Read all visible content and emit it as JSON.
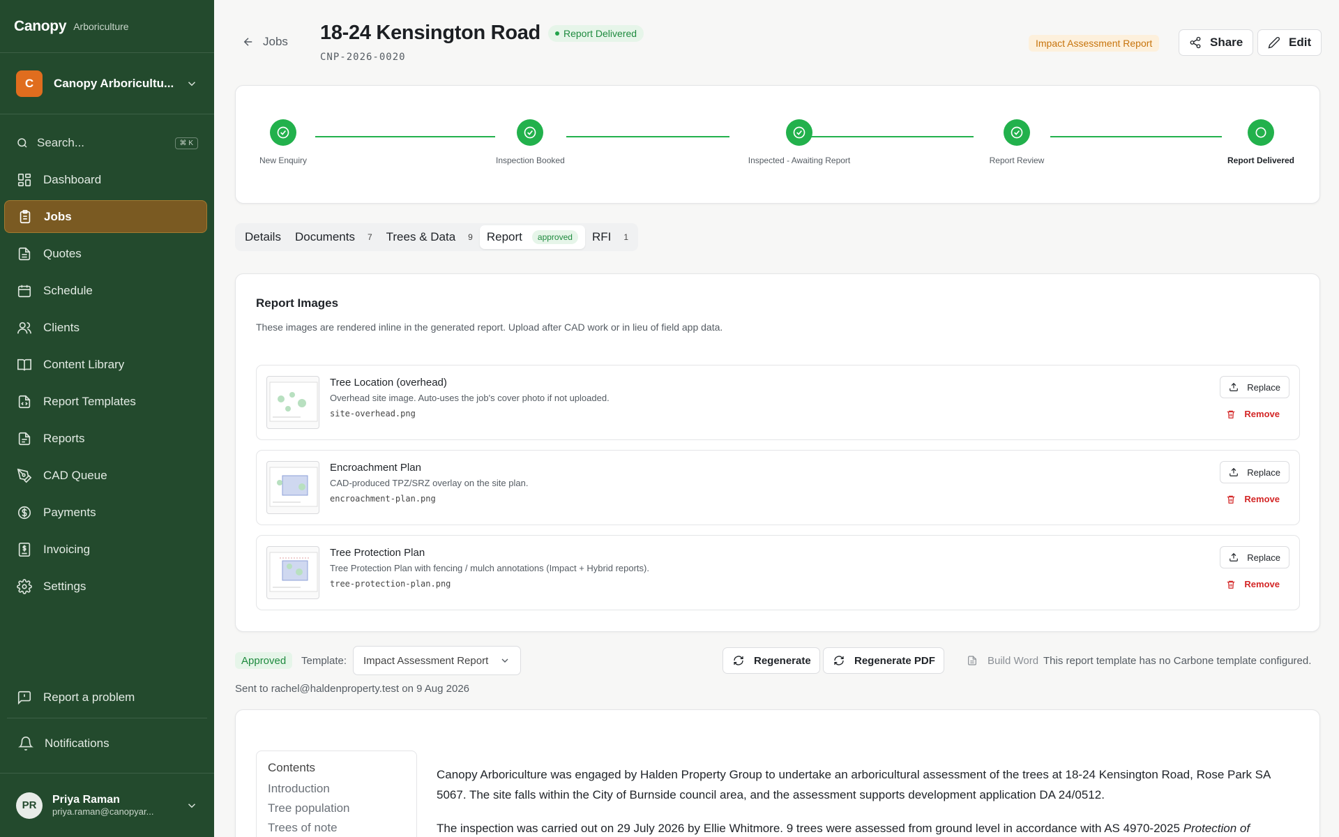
{
  "brand": {
    "name": "Canopy",
    "sub": "Arboriculture"
  },
  "org": {
    "initial": "C",
    "name": "Canopy Arboricultu..."
  },
  "search": {
    "label": "Search...",
    "shortcut": "⌘ K"
  },
  "nav": {
    "items": [
      {
        "label": "Dashboard",
        "icon": "dashboard-icon"
      },
      {
        "label": "Jobs",
        "icon": "clipboard-icon"
      },
      {
        "label": "Quotes",
        "icon": "document-icon"
      },
      {
        "label": "Schedule",
        "icon": "calendar-icon"
      },
      {
        "label": "Clients",
        "icon": "users-icon"
      },
      {
        "label": "Content Library",
        "icon": "book-icon"
      },
      {
        "label": "Report Templates",
        "icon": "file-code-icon"
      },
      {
        "label": "Reports",
        "icon": "file-text-icon"
      },
      {
        "label": "CAD Queue",
        "icon": "pen-tool-icon"
      },
      {
        "label": "Payments",
        "icon": "dollar-circle-icon"
      },
      {
        "label": "Invoicing",
        "icon": "invoice-icon"
      },
      {
        "label": "Settings",
        "icon": "gear-icon"
      }
    ],
    "report_problem": "Report a problem",
    "notifications": "Notifications"
  },
  "user": {
    "initials": "PR",
    "name": "Priya Raman",
    "email": "priya.raman@canopyar..."
  },
  "header": {
    "back_label": "Jobs",
    "title": "18-24 Kensington Road",
    "status": "Report Delivered",
    "job_code": "CNP-2026-0020",
    "report_type": "Impact Assessment Report",
    "share_label": "Share",
    "edit_label": "Edit"
  },
  "stepper": {
    "steps": [
      {
        "label": "New Enquiry",
        "state": "done"
      },
      {
        "label": "Inspection Booked",
        "state": "done"
      },
      {
        "label": "Inspected - Awaiting Report",
        "state": "done"
      },
      {
        "label": "Report Review",
        "state": "done"
      },
      {
        "label": "Report Delivered",
        "state": "current"
      }
    ]
  },
  "tabs": [
    {
      "label": "Details",
      "count": ""
    },
    {
      "label": "Documents",
      "count": "7"
    },
    {
      "label": "Trees & Data",
      "count": "9"
    },
    {
      "label": "Report",
      "badge": "approved"
    },
    {
      "label": "RFI",
      "count": "1"
    }
  ],
  "report_images": {
    "title": "Report Images",
    "subtitle": "These images are rendered inline in the generated report. Upload after CAD work or in lieu of field app data.",
    "replace_label": "Replace",
    "remove_label": "Remove",
    "items": [
      {
        "title": "Tree Location (overhead)",
        "desc": "Overhead site image. Auto-uses the job's cover photo if not uploaded.",
        "file": "site-overhead.png"
      },
      {
        "title": "Encroachment Plan",
        "desc": "CAD-produced TPZ/SRZ overlay on the site plan.",
        "file": "encroachment-plan.png"
      },
      {
        "title": "Tree Protection Plan",
        "desc": "Tree Protection Plan with fencing / mulch annotations (Impact + Hybrid reports).",
        "file": "tree-protection-plan.png"
      }
    ]
  },
  "report_bar": {
    "approved": "Approved",
    "template_label": "Template:",
    "template_value": "Impact Assessment Report",
    "regenerate": "Regenerate",
    "regenerate_pdf": "Regenerate PDF",
    "build_word": "Build Word",
    "carbone_note": "This report template has no Carbone template configured.",
    "sent": "Sent to rachel@haldenproperty.test on 9 Aug 2026"
  },
  "preview": {
    "contents_title": "Contents",
    "contents": [
      "Introduction",
      "Tree population",
      "Trees of note"
    ],
    "para1": "Canopy Arboriculture was engaged by Halden Property Group to undertake an arboricultural assessment of the trees at 18-24 Kensington Road, Rose Park SA 5067. The site falls within the City of Burnside council area, and the assessment supports development application DA 24/0512.",
    "para2_start": "The inspection was carried out on 29 July 2026 by Ellie Whitmore. 9 trees were assessed from ground level in accordance with AS 4970-2025 ",
    "para2_italic": "Protection of"
  },
  "colors": {
    "sidebar": "#234a2d",
    "active_nav": "#7a5a22",
    "success": "#22b14c",
    "danger": "#d32626",
    "accent_orange": "#e06d1e"
  }
}
